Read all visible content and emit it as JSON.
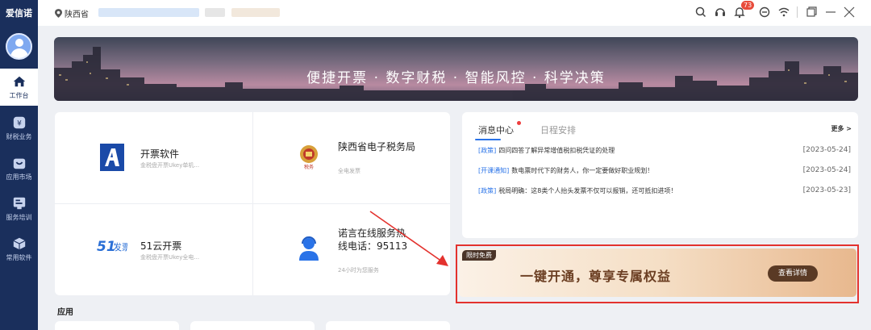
{
  "sidebar": {
    "logo": "爱信诺",
    "items": [
      {
        "label": "工作台",
        "icon": "home-icon",
        "active": true
      },
      {
        "label": "财税业务",
        "icon": "tax-business-icon",
        "active": false
      },
      {
        "label": "应用市场",
        "icon": "app-market-icon",
        "active": false
      },
      {
        "label": "服务培训",
        "icon": "training-icon",
        "active": false
      },
      {
        "label": "常用软件",
        "icon": "software-icon",
        "active": false
      }
    ]
  },
  "topbar": {
    "location": "陕西省",
    "notification_count": "73",
    "icons": [
      "search-icon",
      "headset-icon",
      "bell-icon",
      "minus-circle-icon",
      "wifi-icon",
      "restore-icon",
      "minimize-icon",
      "close-icon"
    ]
  },
  "banner": {
    "text": "便捷开票 · 数字财税 · 智能风控 · 科学决策"
  },
  "software": [
    {
      "title": "开票软件",
      "subtitle": "金税盘开票Ukey单机...",
      "icon": "aisino-logo-icon"
    },
    {
      "title": "陕西省电子税务局",
      "subtitle": "全电发票",
      "icon": "tax-bureau-emblem-icon"
    },
    {
      "title": "51云开票",
      "subtitle": "金税盘开票Ukey全电...",
      "icon": "51fapiao-logo-icon"
    },
    {
      "title": "诺言在线服务热线电话：95113",
      "subtitle": "24小时为您服务",
      "icon": "customer-service-icon"
    }
  ],
  "messages": {
    "tabs": [
      "消息中心",
      "日程安排"
    ],
    "more": "更多 >",
    "items": [
      {
        "tag": "[政策]",
        "text": "四问四答了解异常增值税扣税凭证的处理",
        "date": "[2023-05-24]"
      },
      {
        "tag": "[开课通知]",
        "text": "数电票时代下的财务人，你一定要做好职业规划！",
        "date": "[2023-05-24]"
      },
      {
        "tag": "[政策]",
        "text": "税局明确：这8类个人抬头发票不仅可以报销，还可抵扣进项！",
        "date": "[2023-05-23]"
      }
    ]
  },
  "promo": {
    "tag": "限时免费",
    "title": "一键开通，尊享专属权益",
    "button": "查看详情"
  },
  "apps": {
    "label": "应用"
  },
  "colors": {
    "sidebar": "#1a2f5c",
    "accent": "#2a73e8",
    "highlight_border": "#e3322e",
    "promo_button": "#5a3a25"
  }
}
